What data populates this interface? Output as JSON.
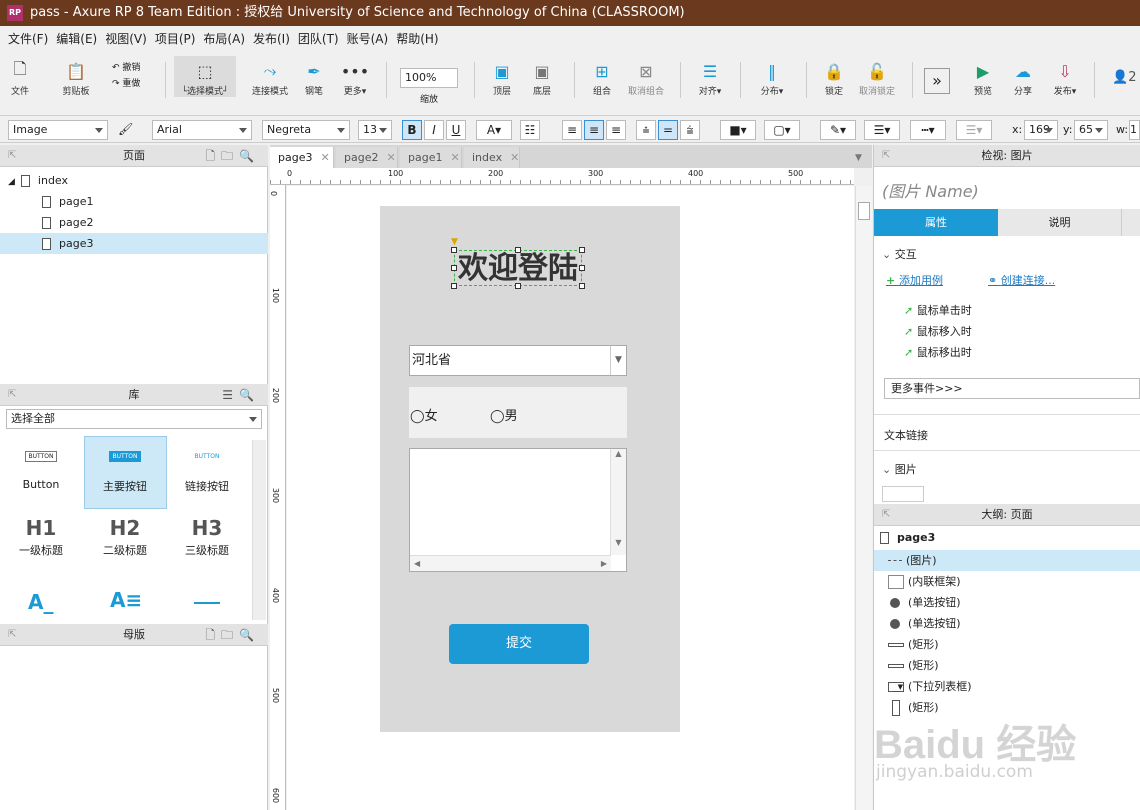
{
  "window": {
    "title": "pass - Axure RP 8 Team Edition : 授权给 University of Science and Technology of China (CLASSROOM)",
    "icon": "RP"
  },
  "menu": [
    "文件(F)",
    "编辑(E)",
    "视图(V)",
    "项目(P)",
    "布局(A)",
    "发布(I)",
    "团队(T)",
    "账号(A)",
    "帮助(H)"
  ],
  "toolbar": {
    "file": "文件",
    "clipboard": "剪贴板",
    "undo": "撤销",
    "redo": "重做",
    "select_mode": "└选择模式┘",
    "connect_mode": "连接模式",
    "pen": "钢笔",
    "more": "更多▾",
    "zoom_value": "100%",
    "zoom": "缩放",
    "top": "顶层",
    "bottom": "底层",
    "group": "组合",
    "ungroup": "取消组合",
    "align": "对齐▾",
    "distribute": "分布▾",
    "lock": "锁定",
    "unlock": "取消锁定",
    "preview": "预览",
    "share": "分享",
    "publish": "发布▾",
    "user": "2"
  },
  "format": {
    "style": "Image",
    "font": "Arial",
    "weight": "Negreta",
    "size": "13",
    "x_label": "x:",
    "x": "169",
    "y_label": "y:",
    "y": "65",
    "w_label": "w:",
    "w": "1"
  },
  "pages_panel": {
    "title": "页面",
    "items": [
      "index",
      "page1",
      "page2",
      "page3"
    ]
  },
  "library": {
    "title": "库",
    "filter": "选择全部",
    "items": [
      {
        "thumb": "BUTTON",
        "label": "Button"
      },
      {
        "thumb": "BUTTON",
        "label": "主要按钮"
      },
      {
        "thumb": "BUTTON",
        "label": "链接按钮"
      },
      {
        "thumb": "H1",
        "label": "一级标题"
      },
      {
        "thumb": "H2",
        "label": "二级标题"
      },
      {
        "thumb": "H3",
        "label": "三级标题"
      }
    ]
  },
  "masters": {
    "title": "母版"
  },
  "tabs": [
    "page3",
    "page2",
    "page1",
    "index"
  ],
  "ruler": {
    "h": [
      "0",
      "100",
      "200",
      "300",
      "400",
      "500"
    ],
    "v": [
      "0",
      "100",
      "200",
      "300",
      "400",
      "500",
      "600"
    ]
  },
  "canvas": {
    "heading": "欢迎登陆",
    "province": "河北省",
    "radio_female": "女",
    "radio_male": "男",
    "submit": "提交"
  },
  "inspector": {
    "title": "检视: 图片",
    "name_placeholder": "(图片 Name)",
    "tab_props": "属性",
    "tab_notes": "说明",
    "interaction": "交互",
    "add_case": "添加用例",
    "create_link": "创建连接...",
    "events": [
      "鼠标单击时",
      "鼠标移入时",
      "鼠标移出时"
    ],
    "more_events": "更多事件>>>",
    "text_link": "文本链接",
    "image": "图片"
  },
  "outline": {
    "title": "大纲: 页面",
    "page": "page3",
    "items": [
      "(图片)",
      "(内联框架)",
      "(单选按钮)",
      "(单选按钮)",
      "(矩形)",
      "(矩形)",
      "(下拉列表框)",
      "(矩形)"
    ]
  },
  "watermark": {
    "brand": "Baidu 经验",
    "url": "jingyan.baidu.com"
  },
  "colors": {
    "accent": "#1c9ad6",
    "title_bar": "#6b3a1e",
    "selection": "#cde8f6"
  }
}
